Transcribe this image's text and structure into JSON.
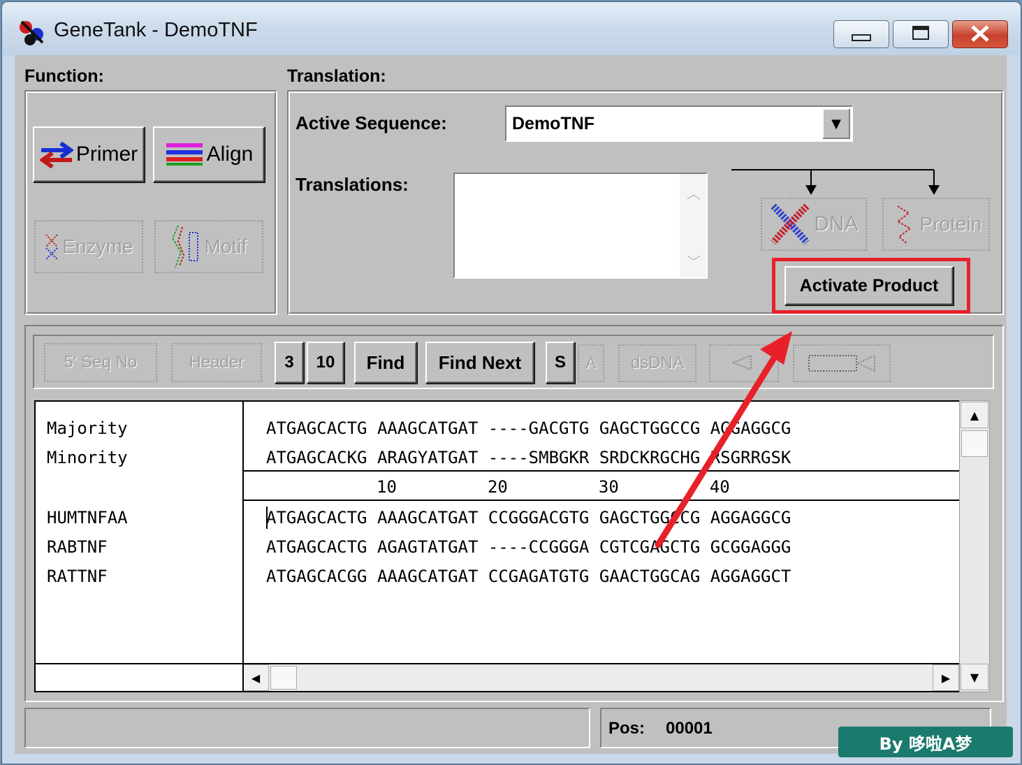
{
  "window": {
    "title": "GeneTank - DemoTNF"
  },
  "function_panel": {
    "label": "Function:",
    "primer": "Primer",
    "align": "Align",
    "enzyme": "Enzyme",
    "motif": "Motif"
  },
  "translation_panel": {
    "label": "Translation:",
    "active_sequence_label": "Active Sequence:",
    "active_sequence_value": "DemoTNF",
    "translations_label": "Translations:",
    "dna": "DNA",
    "protein": "Protein",
    "activate_product": "Activate Product"
  },
  "toolbar": {
    "seq_no": "5' Seq No",
    "header": "Header",
    "group3": "3",
    "group10": "10",
    "find": "Find",
    "find_next": "Find Next",
    "s": "S",
    "a": "A",
    "dsdna": "dsDNA"
  },
  "alignment": {
    "consensus": [
      {
        "name": "Majority",
        "seq": "ATGAGCACTG AAAGCATGAT ----GACGTG GAGCTGGCCG AGGAGGCG"
      },
      {
        "name": "Minority",
        "seq": "ATGAGCACKG ARAGYATGAT ----SMBGKR SRDCKRGCHG RSGRRGSK"
      }
    ],
    "ruler": "10         20         30         40",
    "sequences": [
      {
        "name": "HUMTNFAA",
        "seq": "ATGAGCACTG AAAGCATGAT CCGGGACGTG GAGCTGGCCG AGGAGGCG"
      },
      {
        "name": "RABTNF",
        "seq": "ATGAGCACTG AGAGTATGAT ----CCGGGA CGTCGAGCTG GCGGAGGG"
      },
      {
        "name": "RATTNF",
        "seq": "ATGAGCACGG AAAGCATGAT CCGAGATGTG GAACTGGCAG AGGAGGCT"
      }
    ]
  },
  "status": {
    "pos_label": "Pos:",
    "pos_value": "00001"
  },
  "watermark": "By 哆啦A梦",
  "colors": {
    "highlight": "#e8202a",
    "badge": "#1b7a6e"
  }
}
